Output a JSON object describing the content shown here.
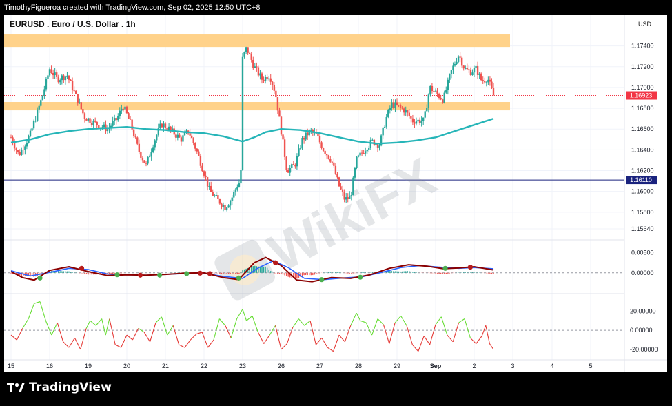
{
  "header": {
    "credit": "TimothyFigueroa created with TradingView.com, Sep 02, 2025 12:50 UTC+8"
  },
  "chart": {
    "symbol_title": "EURUSD . Euro / U.S. Dollar . 1h",
    "currency": "USD",
    "current_price_label": "1.16923",
    "line_level_label": "1.16110",
    "watermark": "WikiFX"
  },
  "footer": {
    "brand": "TradingView",
    "logo_icon": "tradingview-logo-icon"
  },
  "colors": {
    "bull": "#26a69a",
    "bear": "#ef5350",
    "ma": "#26b5b8",
    "zone": "#ffd28a",
    "current": "#f23645",
    "level": "#1a237e"
  },
  "chart_data": [
    {
      "type": "candlestick",
      "title": "EURUSD . Euro / U.S. Dollar . 1h",
      "x_ticks": [
        "15",
        "16",
        "19",
        "20",
        "21",
        "22",
        "23",
        "26",
        "27",
        "28",
        "29",
        "Sep",
        "2",
        "3",
        "4",
        "5"
      ],
      "y_ticks": [
        1.174,
        1.172,
        1.17,
        1.168,
        1.166,
        1.164,
        1.162,
        1.16,
        1.158,
        1.1564
      ],
      "ylim": [
        1.1556,
        1.1755
      ],
      "close_path": [
        [
          0,
          1.1652
        ],
        [
          0.2,
          1.1635
        ],
        [
          0.5,
          1.1655
        ],
        [
          0.8,
          1.169
        ],
        [
          1.0,
          1.1718
        ],
        [
          1.2,
          1.1708
        ],
        [
          1.45,
          1.1712
        ],
        [
          1.7,
          1.169
        ],
        [
          1.9,
          1.1672
        ],
        [
          2.2,
          1.1665
        ],
        [
          2.5,
          1.166
        ],
        [
          2.75,
          1.167
        ],
        [
          2.9,
          1.1683
        ],
        [
          3.1,
          1.1665
        ],
        [
          3.3,
          1.164
        ],
        [
          3.5,
          1.1625
        ],
        [
          3.7,
          1.1648
        ],
        [
          3.9,
          1.1665
        ],
        [
          4.1,
          1.166
        ],
        [
          4.4,
          1.165
        ],
        [
          4.6,
          1.1658
        ],
        [
          4.8,
          1.164
        ],
        [
          5.0,
          1.1618
        ],
        [
          5.15,
          1.16
        ],
        [
          5.35,
          1.1592
        ],
        [
          5.55,
          1.1585
        ],
        [
          5.7,
          1.1592
        ],
        [
          5.85,
          1.1605
        ],
        [
          5.95,
          1.161
        ],
        [
          6.0,
          1.1728
        ],
        [
          6.1,
          1.1738
        ],
        [
          6.3,
          1.172
        ],
        [
          6.5,
          1.1708
        ],
        [
          6.7,
          1.1712
        ],
        [
          6.85,
          1.1695
        ],
        [
          7.0,
          1.1658
        ],
        [
          7.15,
          1.162
        ],
        [
          7.35,
          1.1625
        ],
        [
          7.55,
          1.165
        ],
        [
          7.75,
          1.1658
        ],
        [
          7.9,
          1.1655
        ],
        [
          8.1,
          1.164
        ],
        [
          8.3,
          1.163
        ],
        [
          8.5,
          1.1605
        ],
        [
          8.65,
          1.1592
        ],
        [
          8.8,
          1.1595
        ],
        [
          8.95,
          1.163
        ],
        [
          9.15,
          1.164
        ],
        [
          9.35,
          1.1648
        ],
        [
          9.55,
          1.1645
        ],
        [
          9.7,
          1.1668
        ],
        [
          9.85,
          1.1684
        ],
        [
          10.0,
          1.1682
        ],
        [
          10.2,
          1.1678
        ],
        [
          10.4,
          1.1668
        ],
        [
          10.55,
          1.1668
        ],
        [
          10.7,
          1.1668
        ],
        [
          10.85,
          1.17
        ],
        [
          11.0,
          1.1695
        ],
        [
          11.2,
          1.1688
        ],
        [
          11.4,
          1.1715
        ],
        [
          11.6,
          1.1732
        ],
        [
          11.75,
          1.1718
        ],
        [
          11.9,
          1.1715
        ],
        [
          12.05,
          1.1718
        ],
        [
          12.2,
          1.1706
        ],
        [
          12.35,
          1.1709
        ],
        [
          12.45,
          1.1698
        ],
        [
          12.5,
          1.16923
        ]
      ],
      "moving_average": [
        [
          0,
          1.1647
        ],
        [
          0.5,
          1.165
        ],
        [
          1.0,
          1.1655
        ],
        [
          1.5,
          1.1658
        ],
        [
          2.0,
          1.166
        ],
        [
          2.5,
          1.1661
        ],
        [
          3.0,
          1.1662
        ],
        [
          3.5,
          1.166
        ],
        [
          4.0,
          1.1659
        ],
        [
          4.5,
          1.1657
        ],
        [
          5.0,
          1.1656
        ],
        [
          5.5,
          1.1653
        ],
        [
          6.0,
          1.1648
        ],
        [
          6.3,
          1.1652
        ],
        [
          6.6,
          1.1657
        ],
        [
          7.0,
          1.166
        ],
        [
          7.5,
          1.1659
        ],
        [
          8.0,
          1.1656
        ],
        [
          8.5,
          1.1652
        ],
        [
          9.0,
          1.1648
        ],
        [
          9.5,
          1.1646
        ],
        [
          10.0,
          1.1647
        ],
        [
          10.5,
          1.1649
        ],
        [
          11.0,
          1.1652
        ],
        [
          11.5,
          1.1658
        ],
        [
          12.0,
          1.1664
        ],
        [
          12.5,
          1.167
        ]
      ],
      "zones": [
        {
          "from_x": 0,
          "to_x": 13,
          "low": 1.1739,
          "high": 1.1751
        },
        {
          "from_x": 0,
          "to_x": 13,
          "low": 1.1678,
          "high": 1.1686
        }
      ],
      "horizontal_line": 1.1611,
      "current_price": 1.16923
    },
    {
      "type": "line",
      "name_hint": "macd-panel",
      "y_ticks": [
        0.005,
        0.0
      ],
      "ylim": [
        -0.0045,
        0.0075
      ],
      "points": [
        [
          0,
          0.0003
        ],
        [
          0.3,
          -0.0012
        ],
        [
          0.6,
          -0.0018
        ],
        [
          1.0,
          0.0006
        ],
        [
          1.5,
          0.0015
        ],
        [
          2.0,
          0.0003
        ],
        [
          2.5,
          -0.0007
        ],
        [
          3.0,
          -0.0005
        ],
        [
          3.5,
          -0.0006
        ],
        [
          4.0,
          -0.0004
        ],
        [
          4.5,
          -0.0001
        ],
        [
          5.0,
          0.0
        ],
        [
          5.5,
          -0.0012
        ],
        [
          5.9,
          -0.0017
        ],
        [
          6.3,
          0.0025
        ],
        [
          6.6,
          0.0038
        ],
        [
          7.0,
          0.0018
        ],
        [
          7.4,
          -0.0018
        ],
        [
          7.8,
          -0.0022
        ],
        [
          8.3,
          -0.0012
        ],
        [
          8.8,
          -0.0014
        ],
        [
          9.3,
          -0.0005
        ],
        [
          9.8,
          0.0011
        ],
        [
          10.3,
          0.002
        ],
        [
          10.8,
          0.0016
        ],
        [
          11.2,
          0.001
        ],
        [
          11.6,
          0.0012
        ],
        [
          12.0,
          0.0015
        ],
        [
          12.5,
          0.0007
        ]
      ],
      "signal_points": [
        [
          0,
          0.0005
        ],
        [
          0.5,
          -0.0008
        ],
        [
          1.0,
          0.0001
        ],
        [
          1.5,
          0.0011
        ],
        [
          2.0,
          0.0008
        ],
        [
          2.5,
          -0.0003
        ],
        [
          3.0,
          -0.0005
        ],
        [
          3.5,
          -0.0006
        ],
        [
          4.0,
          -0.0004
        ],
        [
          4.5,
          -0.0002
        ],
        [
          5.0,
          -0.0001
        ],
        [
          5.5,
          -0.0009
        ],
        [
          6.0,
          -0.0014
        ],
        [
          6.4,
          0.0012
        ],
        [
          6.8,
          0.003
        ],
        [
          7.2,
          0.0012
        ],
        [
          7.6,
          -0.0014
        ],
        [
          8.1,
          -0.0017
        ],
        [
          8.6,
          -0.0013
        ],
        [
          9.1,
          -0.001
        ],
        [
          9.6,
          0.0001
        ],
        [
          10.1,
          0.0013
        ],
        [
          10.6,
          0.0018
        ],
        [
          11.1,
          0.0014
        ],
        [
          11.6,
          0.0011
        ],
        [
          12.0,
          0.0013
        ],
        [
          12.5,
          0.001
        ]
      ],
      "crosses": [
        {
          "x": 0.75,
          "y": -0.0013,
          "dir": "up"
        },
        {
          "x": 1.83,
          "y": 0.0011,
          "dir": "down"
        },
        {
          "x": 2.75,
          "y": -0.0005,
          "dir": "up"
        },
        {
          "x": 3.35,
          "y": -0.0006,
          "dir": "down"
        },
        {
          "x": 3.85,
          "y": -0.0006,
          "dir": "up"
        },
        {
          "x": 4.55,
          "y": -0.0002,
          "dir": "up"
        },
        {
          "x": 4.9,
          "y": -0.0001,
          "dir": "down"
        },
        {
          "x": 5.15,
          "y": -0.0002,
          "dir": "down"
        },
        {
          "x": 5.9,
          "y": -0.0013,
          "dir": "up"
        },
        {
          "x": 6.85,
          "y": 0.0025,
          "dir": "down"
        },
        {
          "x": 8.05,
          "y": -0.0017,
          "dir": "up"
        },
        {
          "x": 9.05,
          "y": -0.0011,
          "dir": "up"
        },
        {
          "x": 11.25,
          "y": 0.0011,
          "dir": "up"
        },
        {
          "x": 11.9,
          "y": 0.0014,
          "dir": "down"
        }
      ]
    },
    {
      "type": "line",
      "name_hint": "oscillator-panel",
      "y_ticks": [
        20.0,
        0.0,
        -20.0
      ],
      "y_tick_labels": [
        "20.00000",
        "0.00000",
        "-20.00000"
      ],
      "ylim": [
        -28,
        34
      ],
      "points": [
        [
          0,
          -5
        ],
        [
          0.15,
          -10
        ],
        [
          0.3,
          2
        ],
        [
          0.45,
          12
        ],
        [
          0.6,
          28
        ],
        [
          0.75,
          30
        ],
        [
          0.9,
          10
        ],
        [
          1.05,
          -5
        ],
        [
          1.2,
          8
        ],
        [
          1.35,
          -12
        ],
        [
          1.5,
          -18
        ],
        [
          1.65,
          -8
        ],
        [
          1.8,
          -20
        ],
        [
          1.95,
          2
        ],
        [
          2.05,
          10
        ],
        [
          2.2,
          5
        ],
        [
          2.35,
          12
        ],
        [
          2.45,
          -5
        ],
        [
          2.55,
          12
        ],
        [
          2.7,
          -15
        ],
        [
          2.85,
          -18
        ],
        [
          3.0,
          -5
        ],
        [
          3.15,
          -10
        ],
        [
          3.3,
          2
        ],
        [
          3.45,
          -2
        ],
        [
          3.6,
          -12
        ],
        [
          3.75,
          8
        ],
        [
          3.9,
          14
        ],
        [
          4.05,
          -5
        ],
        [
          4.2,
          5
        ],
        [
          4.35,
          -15
        ],
        [
          4.5,
          -18
        ],
        [
          4.65,
          -10
        ],
        [
          4.8,
          -4
        ],
        [
          4.95,
          -2
        ],
        [
          5.1,
          -18
        ],
        [
          5.25,
          -10
        ],
        [
          5.4,
          12
        ],
        [
          5.55,
          5
        ],
        [
          5.7,
          -8
        ],
        [
          5.85,
          12
        ],
        [
          6.0,
          22
        ],
        [
          6.1,
          10
        ],
        [
          6.25,
          15
        ],
        [
          6.4,
          -2
        ],
        [
          6.55,
          -14
        ],
        [
          6.7,
          -5
        ],
        [
          6.85,
          5
        ],
        [
          7.0,
          -20
        ],
        [
          7.15,
          -14
        ],
        [
          7.3,
          3
        ],
        [
          7.45,
          12
        ],
        [
          7.6,
          5
        ],
        [
          7.75,
          10
        ],
        [
          7.9,
          -15
        ],
        [
          8.05,
          -8
        ],
        [
          8.2,
          -18
        ],
        [
          8.35,
          -22
        ],
        [
          8.5,
          -5
        ],
        [
          8.65,
          -12
        ],
        [
          8.8,
          5
        ],
        [
          8.95,
          18
        ],
        [
          9.05,
          10
        ],
        [
          9.2,
          8
        ],
        [
          9.35,
          -5
        ],
        [
          9.5,
          12
        ],
        [
          9.65,
          6
        ],
        [
          9.8,
          -14
        ],
        [
          9.95,
          8
        ],
        [
          10.1,
          15
        ],
        [
          10.25,
          5
        ],
        [
          10.4,
          -15
        ],
        [
          10.55,
          -22
        ],
        [
          10.7,
          -6
        ],
        [
          10.85,
          -15
        ],
        [
          11.0,
          6
        ],
        [
          11.15,
          14
        ],
        [
          11.3,
          -5
        ],
        [
          11.45,
          -12
        ],
        [
          11.6,
          8
        ],
        [
          11.75,
          12
        ],
        [
          11.9,
          -8
        ],
        [
          12.05,
          -14
        ],
        [
          12.2,
          -6
        ],
        [
          12.3,
          5
        ],
        [
          12.4,
          -14
        ],
        [
          12.5,
          -20
        ]
      ]
    }
  ]
}
